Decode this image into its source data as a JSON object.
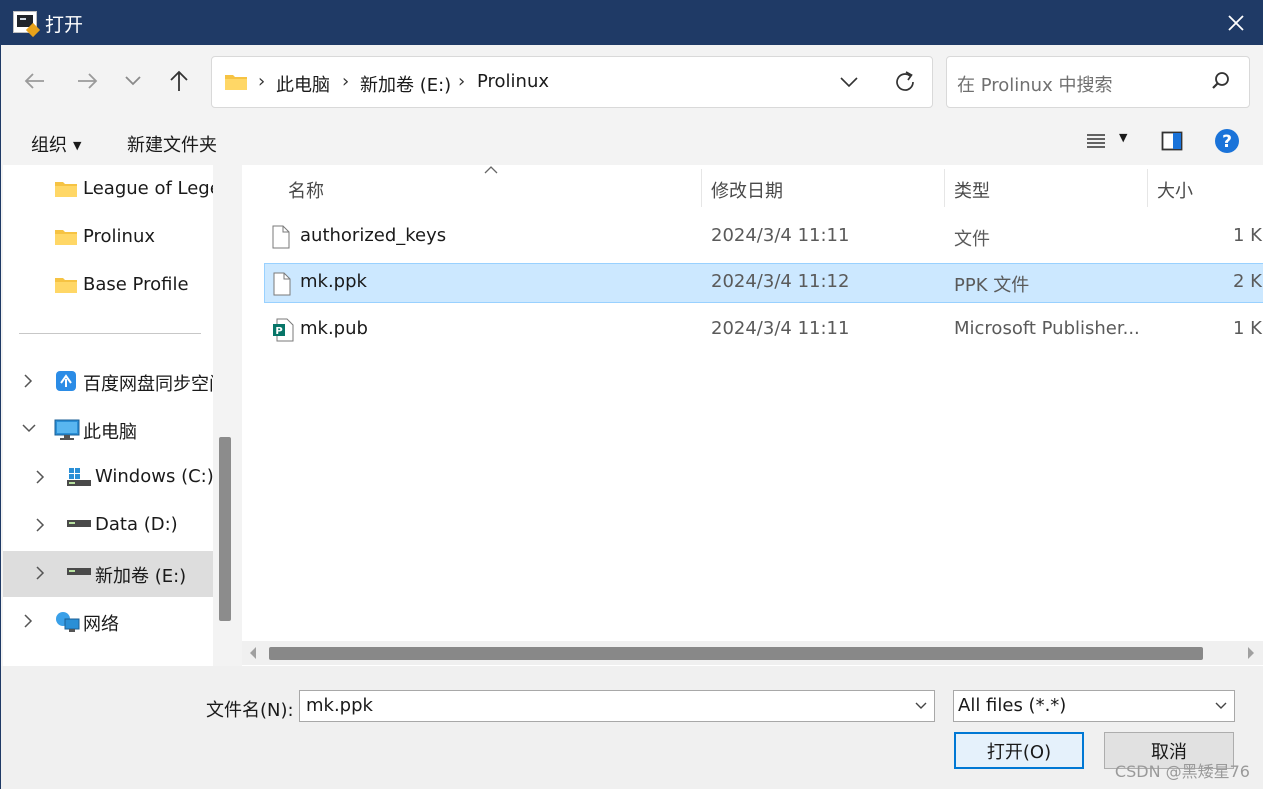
{
  "window": {
    "title": "打开",
    "app_icon": "terminal-app-icon",
    "close_icon": "close-icon"
  },
  "navigation": {
    "back_icon": "arrow-left-icon",
    "forward_icon": "arrow-right-icon",
    "recent_icon": "chevron-down-icon",
    "up_icon": "arrow-up-icon",
    "breadcrumb": [
      "此电脑",
      "新加卷 (E:)",
      "Prolinux"
    ],
    "search_placeholder": "在 Prolinux 中搜索"
  },
  "command_bar": {
    "organize_label": "组织",
    "new_folder_label": "新建文件夹"
  },
  "sidebar": {
    "items": [
      {
        "label": "League of Legends",
        "icon": "folder-icon"
      },
      {
        "label": "Prolinux",
        "icon": "folder-icon"
      },
      {
        "label": "Base Profile",
        "icon": "folder-icon"
      },
      {
        "label": "百度网盘同步空间",
        "icon": "baidu-netdisk-icon"
      },
      {
        "label": "此电脑",
        "icon": "computer-icon"
      },
      {
        "label": "Windows (C:)",
        "icon": "windows-drive-icon"
      },
      {
        "label": "Data (D:)",
        "icon": "drive-icon"
      },
      {
        "label": "新加卷 (E:)",
        "icon": "drive-icon",
        "selected": true
      },
      {
        "label": "网络",
        "icon": "network-icon"
      }
    ]
  },
  "file_list": {
    "columns": [
      "名称",
      "修改日期",
      "类型",
      "大小"
    ],
    "rows": [
      {
        "name": "authorized_keys",
        "date": "2024/3/4 11:11",
        "type": "文件",
        "size": "1 K",
        "icon": "file-icon"
      },
      {
        "name": "mk.ppk",
        "date": "2024/3/4 11:12",
        "type": "PPK 文件",
        "size": "2 K",
        "icon": "file-icon",
        "selected": true
      },
      {
        "name": "mk.pub",
        "date": "2024/3/4 11:11",
        "type": "Microsoft Publisher...",
        "size": "1 K",
        "icon": "publisher-icon"
      }
    ]
  },
  "bottom": {
    "filename_label": "文件名(N):",
    "filename_value": "mk.ppk",
    "filetype_value": "All files (*.*)",
    "open_label": "打开(O)",
    "cancel_label": "取消"
  },
  "watermark": "CSDN @黑矮星76",
  "colors": {
    "titlebar": "#1f3a66",
    "selection": "#cce8ff",
    "accent": "#0078d4",
    "help": "#1a73d9"
  }
}
